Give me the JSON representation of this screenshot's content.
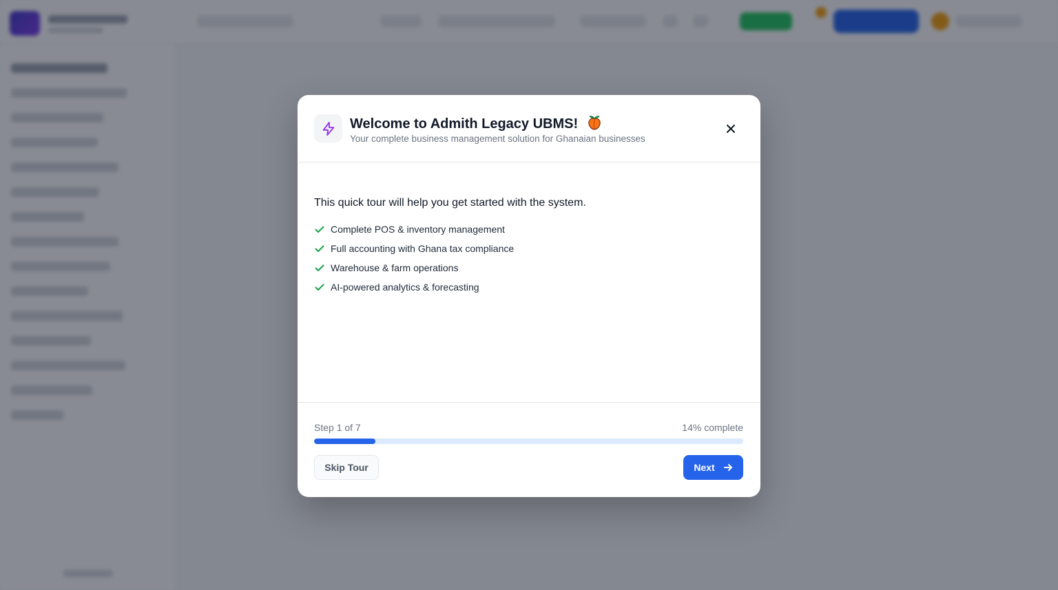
{
  "modal": {
    "title": "Welcome to Admith Legacy UBMS!",
    "title_emoji": "peach-emoji",
    "subtitle": "Your complete business management solution for Ghanaian businesses",
    "header_icon": "lightning-icon",
    "close_icon": "close-icon",
    "intro": "This quick tour will help you get started with the system.",
    "features": [
      "Complete POS & inventory management",
      "Full accounting with Ghana tax compliance",
      "Warehouse & farm operations",
      "AI-powered analytics & forecasting"
    ],
    "feature_icon": "check-icon",
    "step_text": "Step 1 of 7",
    "percent_text": "14% complete",
    "progress_fraction": 0.143,
    "skip_label": "Skip Tour",
    "next_label": "Next",
    "next_icon": "arrow-right-icon"
  },
  "colors": {
    "accent": "#2563eb",
    "icon_purple": "#9333ea",
    "check_green": "#16a34a",
    "overlay": "rgba(17,24,39,0.5)"
  }
}
